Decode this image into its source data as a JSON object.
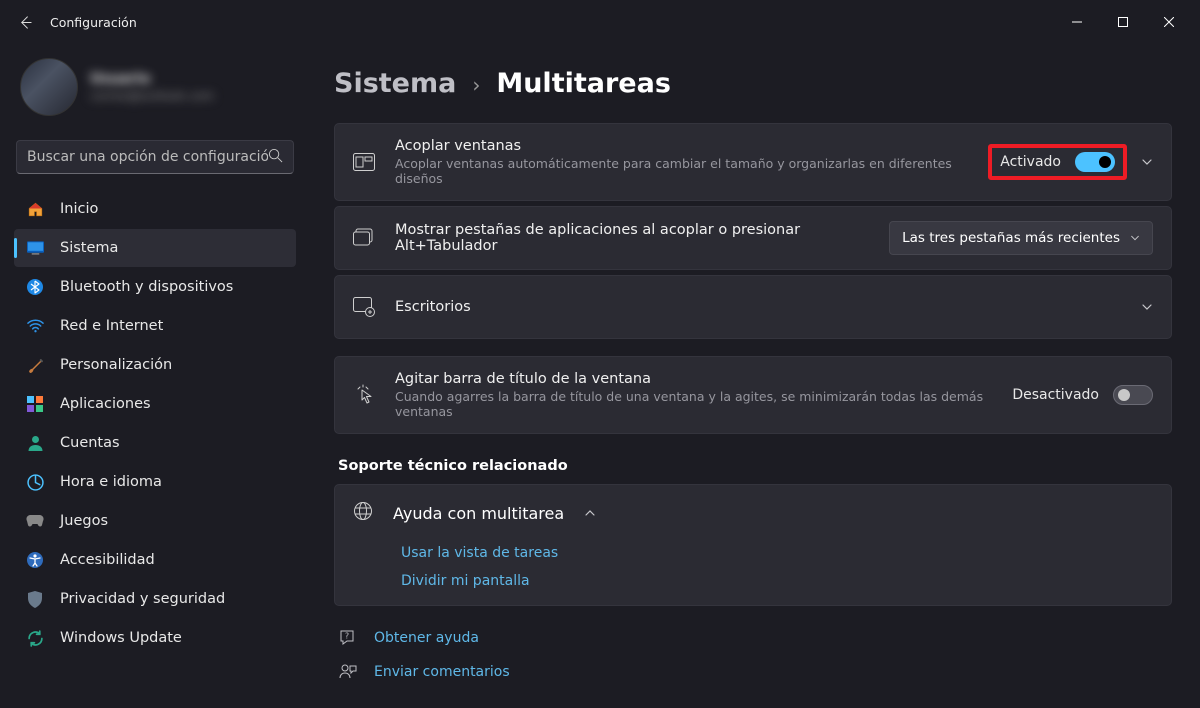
{
  "titlebar": {
    "title": "Configuración"
  },
  "profile": {
    "name": "Usuario",
    "email": "correo@outlook.com"
  },
  "search": {
    "placeholder": "Buscar una opción de configuración"
  },
  "nav": {
    "home": "Inicio",
    "system": "Sistema",
    "bluetooth": "Bluetooth y dispositivos",
    "network": "Red e Internet",
    "personalization": "Personalización",
    "apps": "Aplicaciones",
    "accounts": "Cuentas",
    "time": "Hora e idioma",
    "gaming": "Juegos",
    "accessibility": "Accesibilidad",
    "privacy": "Privacidad y seguridad",
    "update": "Windows Update"
  },
  "breadcrumb": {
    "parent": "Sistema",
    "sep": "›",
    "current": "Multitareas"
  },
  "cards": {
    "snap": {
      "title": "Acoplar ventanas",
      "sub": "Acoplar ventanas automáticamente para cambiar el tamaño y organizarlas en diferentes diseños",
      "state": "Activado"
    },
    "alttab": {
      "title": "Mostrar pestañas de aplicaciones al acoplar o presionar Alt+Tabulador",
      "dropdown": "Las tres pestañas más recientes"
    },
    "desktops": {
      "title": "Escritorios"
    },
    "shake": {
      "title": "Agitar barra de título de la ventana",
      "sub": "Cuando agarres la barra de título de una ventana y la agites, se minimizarán todas las demás ventanas",
      "state": "Desactivado"
    }
  },
  "support": {
    "heading": "Soporte técnico relacionado",
    "help_title": "Ayuda con multitarea",
    "link1": "Usar la vista de tareas",
    "link2": "Dividir mi pantalla"
  },
  "footer": {
    "get_help": "Obtener ayuda",
    "feedback": "Enviar comentarios"
  }
}
